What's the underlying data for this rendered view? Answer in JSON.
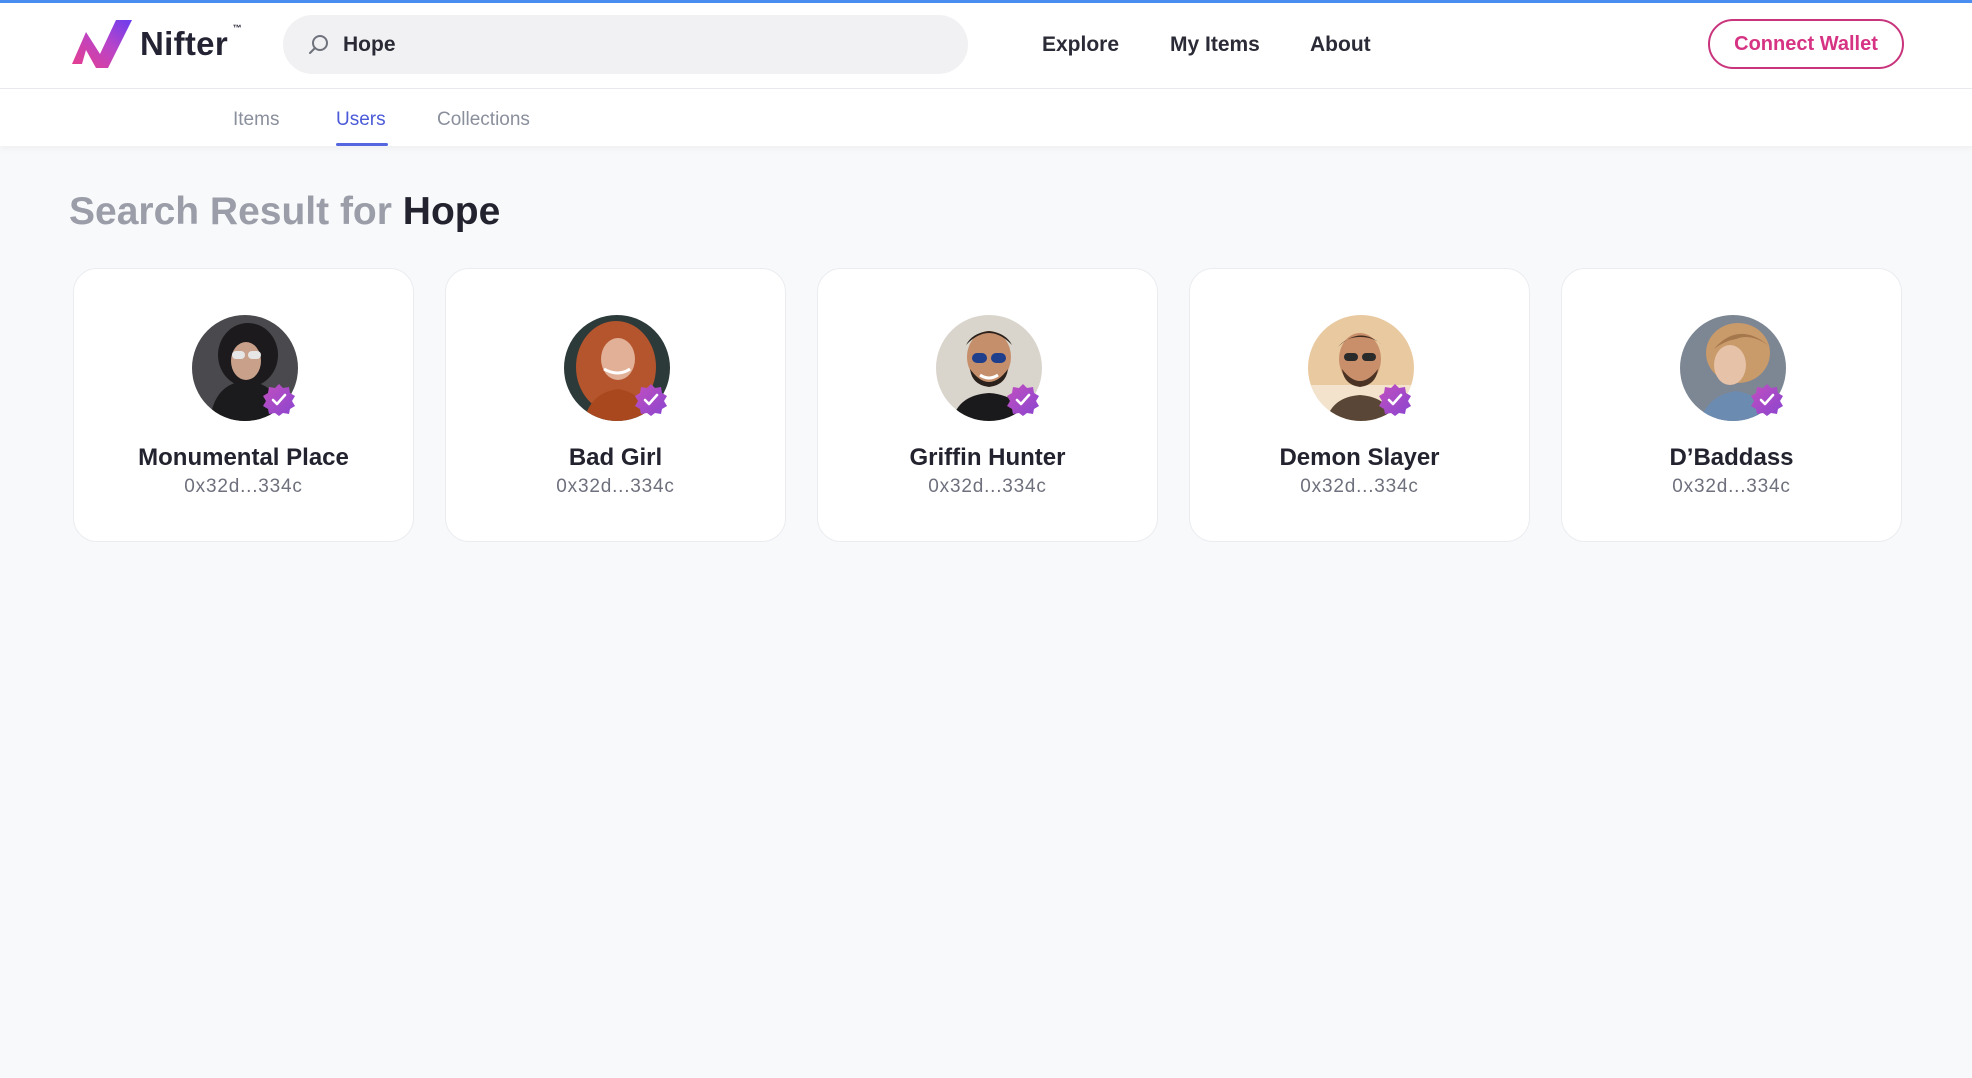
{
  "brand": {
    "name": "Nifter",
    "tm": "™"
  },
  "search": {
    "value": "Hope",
    "placeholder": "Search"
  },
  "nav": {
    "explore": "Explore",
    "my_items": "My Items",
    "about": "About"
  },
  "header": {
    "connect_wallet": "Connect Wallet"
  },
  "tabs": [
    {
      "label": "Items",
      "active": false
    },
    {
      "label": "Users",
      "active": true
    },
    {
      "label": "Collections",
      "active": false
    }
  ],
  "results": {
    "heading_prefix": "Search Result for",
    "query": "Hope"
  },
  "users": [
    {
      "name": "Monumental Place",
      "address": "0x32d...334c",
      "verified": true
    },
    {
      "name": "Bad Girl",
      "address": "0x32d...334c",
      "verified": true
    },
    {
      "name": "Griffin Hunter",
      "address": "0x32d...334c",
      "verified": true
    },
    {
      "name": "Demon Slayer",
      "address": "0x32d...334c",
      "verified": true
    },
    {
      "name": "D’Baddass",
      "address": "0x32d...334c",
      "verified": true
    }
  ],
  "colors": {
    "accent": "#5566e0",
    "brand_pink": "#d63384",
    "verified_badge": "#a24bc4",
    "background": "#f8f9fb"
  }
}
